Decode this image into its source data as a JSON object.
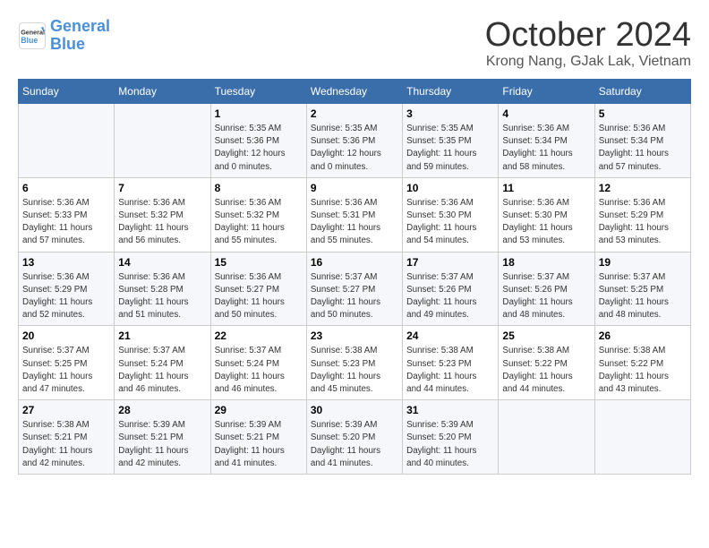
{
  "header": {
    "logo_line1": "General",
    "logo_line2": "Blue",
    "month_title": "October 2024",
    "location": "Krong Nang, GJak Lak, Vietnam"
  },
  "days_of_week": [
    "Sunday",
    "Monday",
    "Tuesday",
    "Wednesday",
    "Thursday",
    "Friday",
    "Saturday"
  ],
  "weeks": [
    [
      {
        "day": "",
        "info": ""
      },
      {
        "day": "",
        "info": ""
      },
      {
        "day": "1",
        "info": "Sunrise: 5:35 AM\nSunset: 5:36 PM\nDaylight: 12 hours\nand 0 minutes."
      },
      {
        "day": "2",
        "info": "Sunrise: 5:35 AM\nSunset: 5:36 PM\nDaylight: 12 hours\nand 0 minutes."
      },
      {
        "day": "3",
        "info": "Sunrise: 5:35 AM\nSunset: 5:35 PM\nDaylight: 11 hours\nand 59 minutes."
      },
      {
        "day": "4",
        "info": "Sunrise: 5:36 AM\nSunset: 5:34 PM\nDaylight: 11 hours\nand 58 minutes."
      },
      {
        "day": "5",
        "info": "Sunrise: 5:36 AM\nSunset: 5:34 PM\nDaylight: 11 hours\nand 57 minutes."
      }
    ],
    [
      {
        "day": "6",
        "info": "Sunrise: 5:36 AM\nSunset: 5:33 PM\nDaylight: 11 hours\nand 57 minutes."
      },
      {
        "day": "7",
        "info": "Sunrise: 5:36 AM\nSunset: 5:32 PM\nDaylight: 11 hours\nand 56 minutes."
      },
      {
        "day": "8",
        "info": "Sunrise: 5:36 AM\nSunset: 5:32 PM\nDaylight: 11 hours\nand 55 minutes."
      },
      {
        "day": "9",
        "info": "Sunrise: 5:36 AM\nSunset: 5:31 PM\nDaylight: 11 hours\nand 55 minutes."
      },
      {
        "day": "10",
        "info": "Sunrise: 5:36 AM\nSunset: 5:30 PM\nDaylight: 11 hours\nand 54 minutes."
      },
      {
        "day": "11",
        "info": "Sunrise: 5:36 AM\nSunset: 5:30 PM\nDaylight: 11 hours\nand 53 minutes."
      },
      {
        "day": "12",
        "info": "Sunrise: 5:36 AM\nSunset: 5:29 PM\nDaylight: 11 hours\nand 53 minutes."
      }
    ],
    [
      {
        "day": "13",
        "info": "Sunrise: 5:36 AM\nSunset: 5:29 PM\nDaylight: 11 hours\nand 52 minutes."
      },
      {
        "day": "14",
        "info": "Sunrise: 5:36 AM\nSunset: 5:28 PM\nDaylight: 11 hours\nand 51 minutes."
      },
      {
        "day": "15",
        "info": "Sunrise: 5:36 AM\nSunset: 5:27 PM\nDaylight: 11 hours\nand 50 minutes."
      },
      {
        "day": "16",
        "info": "Sunrise: 5:37 AM\nSunset: 5:27 PM\nDaylight: 11 hours\nand 50 minutes."
      },
      {
        "day": "17",
        "info": "Sunrise: 5:37 AM\nSunset: 5:26 PM\nDaylight: 11 hours\nand 49 minutes."
      },
      {
        "day": "18",
        "info": "Sunrise: 5:37 AM\nSunset: 5:26 PM\nDaylight: 11 hours\nand 48 minutes."
      },
      {
        "day": "19",
        "info": "Sunrise: 5:37 AM\nSunset: 5:25 PM\nDaylight: 11 hours\nand 48 minutes."
      }
    ],
    [
      {
        "day": "20",
        "info": "Sunrise: 5:37 AM\nSunset: 5:25 PM\nDaylight: 11 hours\nand 47 minutes."
      },
      {
        "day": "21",
        "info": "Sunrise: 5:37 AM\nSunset: 5:24 PM\nDaylight: 11 hours\nand 46 minutes."
      },
      {
        "day": "22",
        "info": "Sunrise: 5:37 AM\nSunset: 5:24 PM\nDaylight: 11 hours\nand 46 minutes."
      },
      {
        "day": "23",
        "info": "Sunrise: 5:38 AM\nSunset: 5:23 PM\nDaylight: 11 hours\nand 45 minutes."
      },
      {
        "day": "24",
        "info": "Sunrise: 5:38 AM\nSunset: 5:23 PM\nDaylight: 11 hours\nand 44 minutes."
      },
      {
        "day": "25",
        "info": "Sunrise: 5:38 AM\nSunset: 5:22 PM\nDaylight: 11 hours\nand 44 minutes."
      },
      {
        "day": "26",
        "info": "Sunrise: 5:38 AM\nSunset: 5:22 PM\nDaylight: 11 hours\nand 43 minutes."
      }
    ],
    [
      {
        "day": "27",
        "info": "Sunrise: 5:38 AM\nSunset: 5:21 PM\nDaylight: 11 hours\nand 42 minutes."
      },
      {
        "day": "28",
        "info": "Sunrise: 5:39 AM\nSunset: 5:21 PM\nDaylight: 11 hours\nand 42 minutes."
      },
      {
        "day": "29",
        "info": "Sunrise: 5:39 AM\nSunset: 5:21 PM\nDaylight: 11 hours\nand 41 minutes."
      },
      {
        "day": "30",
        "info": "Sunrise: 5:39 AM\nSunset: 5:20 PM\nDaylight: 11 hours\nand 41 minutes."
      },
      {
        "day": "31",
        "info": "Sunrise: 5:39 AM\nSunset: 5:20 PM\nDaylight: 11 hours\nand 40 minutes."
      },
      {
        "day": "",
        "info": ""
      },
      {
        "day": "",
        "info": ""
      }
    ]
  ]
}
